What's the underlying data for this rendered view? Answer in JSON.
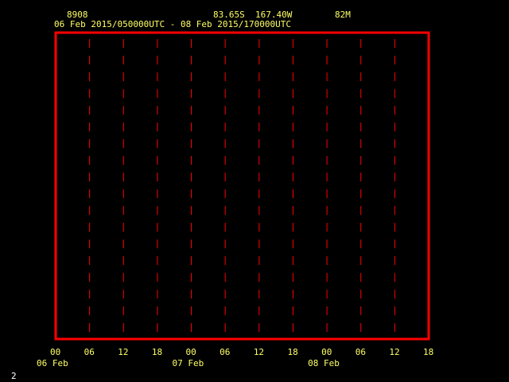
{
  "header": {
    "station_id": "8908",
    "location": "83.65S  167.40W",
    "elevation": "82M",
    "time_range": "06 Feb 2015/050000UTC - 08 Feb 2015/170000UTC"
  },
  "chart_data": {
    "type": "line",
    "x_range": [
      "06 Feb 2015 00UTC",
      "08 Feb 2015 18UTC"
    ],
    "x_tick_labels": [
      "00",
      "06",
      "12",
      "18",
      "00",
      "06",
      "12",
      "18",
      "00",
      "06",
      "12",
      "18"
    ],
    "x_date_labels": [
      "06 Feb",
      "07 Feb",
      "08 Feb"
    ],
    "vertical_gridlines_at_ticks": [
      "06",
      "12",
      "18",
      "00",
      "06",
      "12",
      "18",
      "00",
      "06",
      "12"
    ],
    "series": [],
    "grid": true,
    "colors": {
      "frame": "#ff0000",
      "grid": "#ff0000",
      "text": "#ffff66"
    }
  },
  "footer": {
    "page_number": "2"
  }
}
